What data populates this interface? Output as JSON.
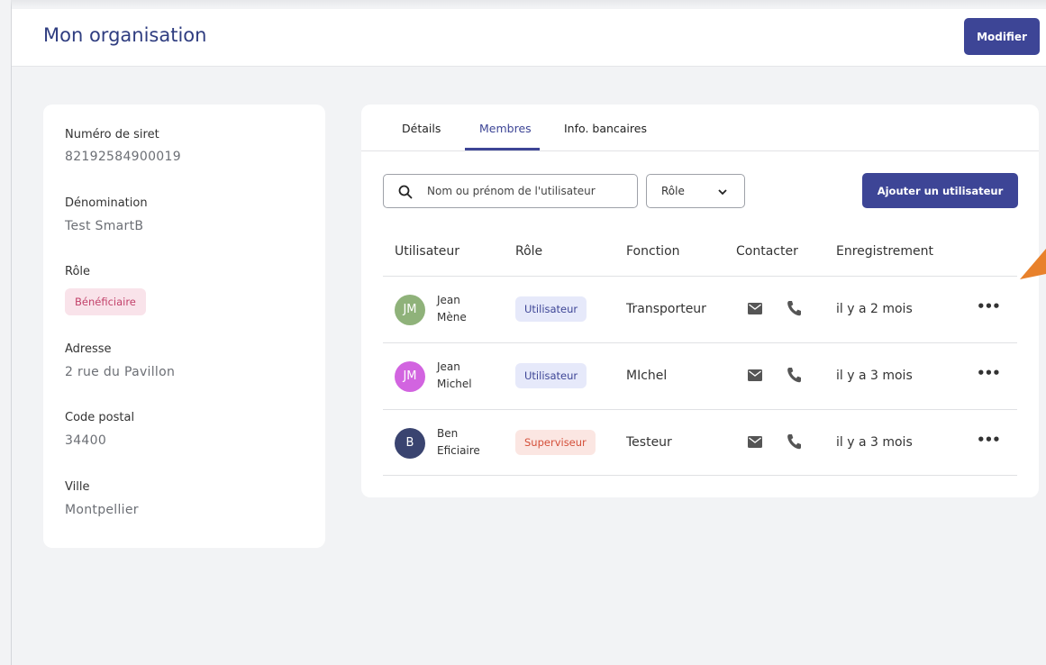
{
  "header": {
    "title": "Mon organisation",
    "edit_label": "Modifier"
  },
  "info": {
    "siret_label": "Numéro de siret",
    "siret_value": "82192584900019",
    "denomination_label": "Dénomination",
    "denomination_value": "Test SmartB",
    "role_label": "Rôle",
    "role_value": "Bénéficiaire",
    "address_label": "Adresse",
    "address_value": "2 rue du Pavillon",
    "postal_label": "Code postal",
    "postal_value": "34400",
    "city_label": "Ville",
    "city_value": "Montpellier"
  },
  "tabs": [
    {
      "label": "Détails"
    },
    {
      "label": "Membres"
    },
    {
      "label": "Info. bancaires"
    }
  ],
  "search": {
    "placeholder": "Nom ou prénom de l'utilisateur"
  },
  "role_filter": {
    "selected": "Rôle"
  },
  "add_user_label": "Ajouter un utilisateur",
  "table": {
    "headers": [
      "Utilisateur",
      "Rôle",
      "Fonction",
      "Contacter",
      "Enregistrement"
    ],
    "rows": [
      {
        "initials": "JM",
        "avatar_color": "#8fb27a",
        "first": "Jean",
        "last": "Mène",
        "role": "Utilisateur",
        "function": "Transporteur",
        "registered": "il y a 2 mois"
      },
      {
        "initials": "JM",
        "avatar_color": "#d264e0",
        "first": "Jean",
        "last": "Michel",
        "role": "Utilisateur",
        "function": "MIchel",
        "registered": "il y a 3 mois"
      },
      {
        "initials": "B",
        "avatar_color": "#3a4470",
        "first": "Ben",
        "last": "Eficiaire",
        "role": "Superviseur",
        "function": "Testeur",
        "registered": "il y a 3 mois"
      }
    ]
  },
  "colors": {
    "primary": "#3d4596",
    "badge_beneficiary_bg": "#f9e3ea",
    "badge_user_bg": "#e6e9fa",
    "badge_supervisor_bg": "#fbe6e2",
    "annotation_arrow": "#e8812b"
  },
  "icons": {
    "search": "search-icon",
    "dropdown": "chevron-down-icon",
    "mail": "mail-icon",
    "phone": "phone-icon",
    "more": "more-options-icon"
  }
}
